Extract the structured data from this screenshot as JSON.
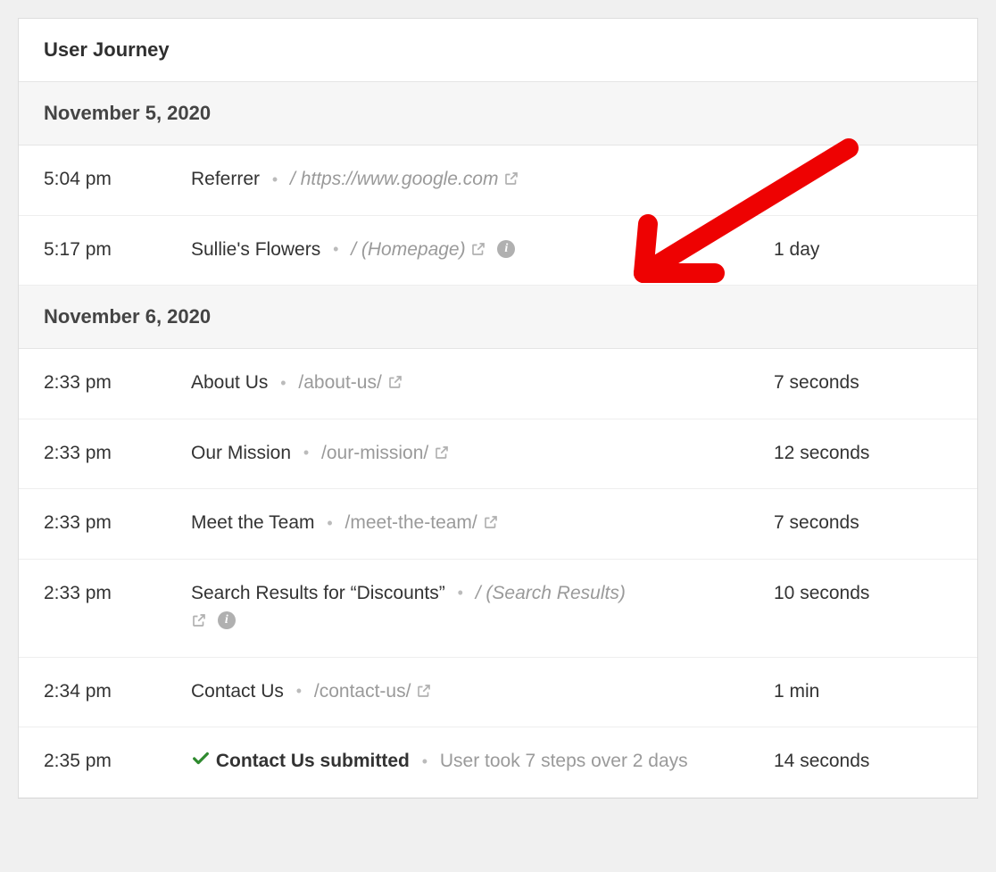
{
  "panel": {
    "title": "User Journey"
  },
  "days": [
    {
      "date": "November 5, 2020",
      "rows": [
        {
          "time": "5:04 pm",
          "title": "Referrer",
          "path": "/ https://www.google.com",
          "pathItalic": true,
          "hasExternal": true,
          "hasInfo": false,
          "duration": ""
        },
        {
          "time": "5:17 pm",
          "title": "Sullie's Flowers",
          "path": "/ (Homepage)",
          "pathItalic": true,
          "hasExternal": true,
          "hasInfo": true,
          "duration": "1 day"
        }
      ]
    },
    {
      "date": "November 6, 2020",
      "rows": [
        {
          "time": "2:33 pm",
          "title": "About Us",
          "path": "/about-us/",
          "pathItalic": false,
          "hasExternal": true,
          "hasInfo": false,
          "duration": "7 seconds"
        },
        {
          "time": "2:33 pm",
          "title": "Our Mission",
          "path": "/our-mission/",
          "pathItalic": false,
          "hasExternal": true,
          "hasInfo": false,
          "duration": "12 seconds"
        },
        {
          "time": "2:33 pm",
          "title": "Meet the Team",
          "path": "/meet-the-team/",
          "pathItalic": false,
          "hasExternal": true,
          "hasInfo": false,
          "duration": "7 seconds"
        },
        {
          "time": "2:33 pm",
          "title": "Search Results for “Discounts”",
          "path": "/ (Search Results)",
          "pathItalic": true,
          "hasExternal": true,
          "hasInfo": true,
          "duration": "10 seconds"
        },
        {
          "time": "2:34 pm",
          "title": "Contact Us",
          "path": "/contact-us/",
          "pathItalic": false,
          "hasExternal": true,
          "hasInfo": false,
          "duration": "1 min"
        },
        {
          "time": "2:35 pm",
          "isSuccess": true,
          "title": "Contact Us submitted",
          "summary": "User took 7 steps over 2 days",
          "duration": "14 seconds"
        }
      ]
    }
  ],
  "annotation": {
    "arrowColor": "#ee0202"
  }
}
